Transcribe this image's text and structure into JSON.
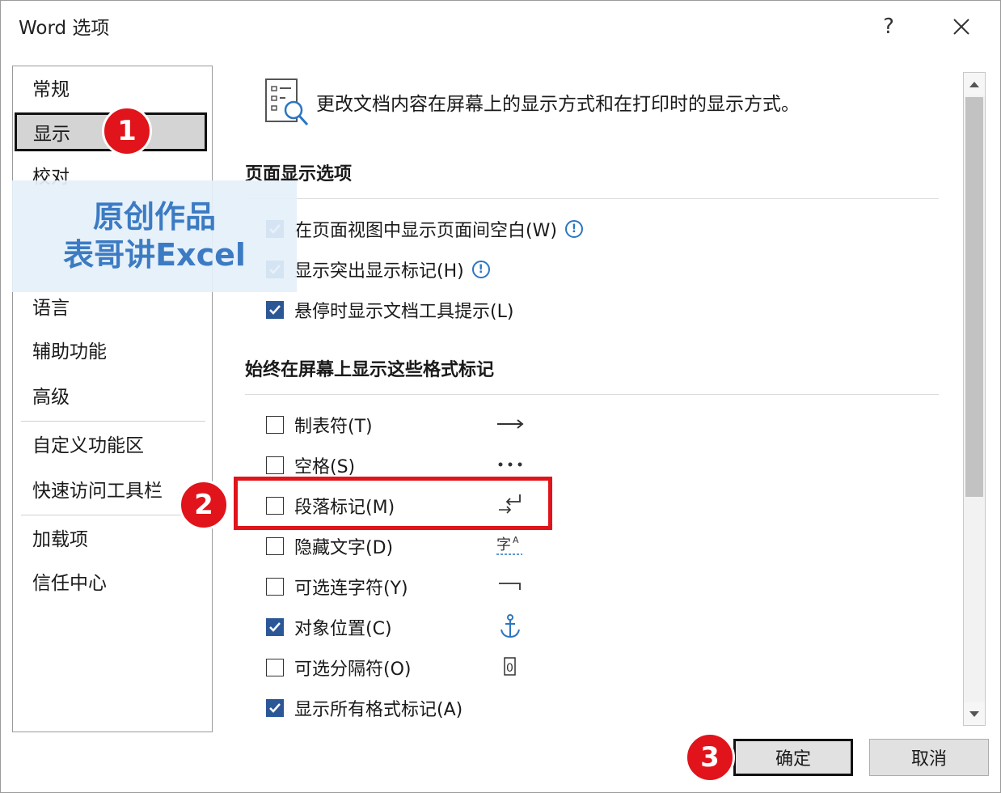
{
  "window": {
    "title": "Word 选项",
    "help_icon": "question-mark-icon",
    "close_icon": "close-icon"
  },
  "nav": {
    "items": [
      {
        "label": "常规"
      },
      {
        "label": "显示",
        "selected": true
      },
      {
        "label": "校对"
      },
      {
        "label": "语言"
      },
      {
        "label": "辅助功能"
      },
      {
        "label": "高级"
      },
      {
        "label": "自定义功能区"
      },
      {
        "label": "快速访问工具栏"
      },
      {
        "label": "加载项"
      },
      {
        "label": "信任中心"
      }
    ]
  },
  "watermark": {
    "line1": "原创作品",
    "line2": "表哥讲Excel"
  },
  "content": {
    "description": "更改文档内容在屏幕上的显示方式和在打印时的显示方式。",
    "section_page": {
      "title": "页面显示选项",
      "options": [
        {
          "label": "在页面视图中显示页面间空白(W)",
          "checked": true,
          "info": true
        },
        {
          "label": "显示突出显示标记(H)",
          "checked": true,
          "info": true
        },
        {
          "label": "悬停时显示文档工具提示(L)",
          "checked": true,
          "info": false
        }
      ]
    },
    "section_marks": {
      "title": "始终在屏幕上显示这些格式标记",
      "options": [
        {
          "label": "制表符(T)",
          "checked": false,
          "symbol": "→"
        },
        {
          "label": "空格(S)",
          "checked": false,
          "symbol": "•••"
        },
        {
          "label": "段落标记(M)",
          "checked": false,
          "symbol": "↵"
        },
        {
          "label": "隐藏文字(D)",
          "checked": false,
          "symbol": "字ᴬ"
        },
        {
          "label": "可选连字符(Y)",
          "checked": false,
          "symbol": "¬"
        },
        {
          "label": "对象位置(C)",
          "checked": true,
          "symbol": "anchor-icon"
        },
        {
          "label": "可选分隔符(O)",
          "checked": false,
          "symbol": "0"
        },
        {
          "label": "显示所有格式标记(A)",
          "checked": true,
          "symbol": ""
        }
      ]
    }
  },
  "buttons": {
    "ok": "确定",
    "cancel": "取消"
  },
  "annotations": {
    "step1": "1",
    "step2": "2",
    "step3": "3",
    "color": "#e0141a"
  },
  "colors": {
    "accent": "#2b5797",
    "info": "#2b76c2",
    "selected_nav_bg": "#d4d4d4"
  }
}
